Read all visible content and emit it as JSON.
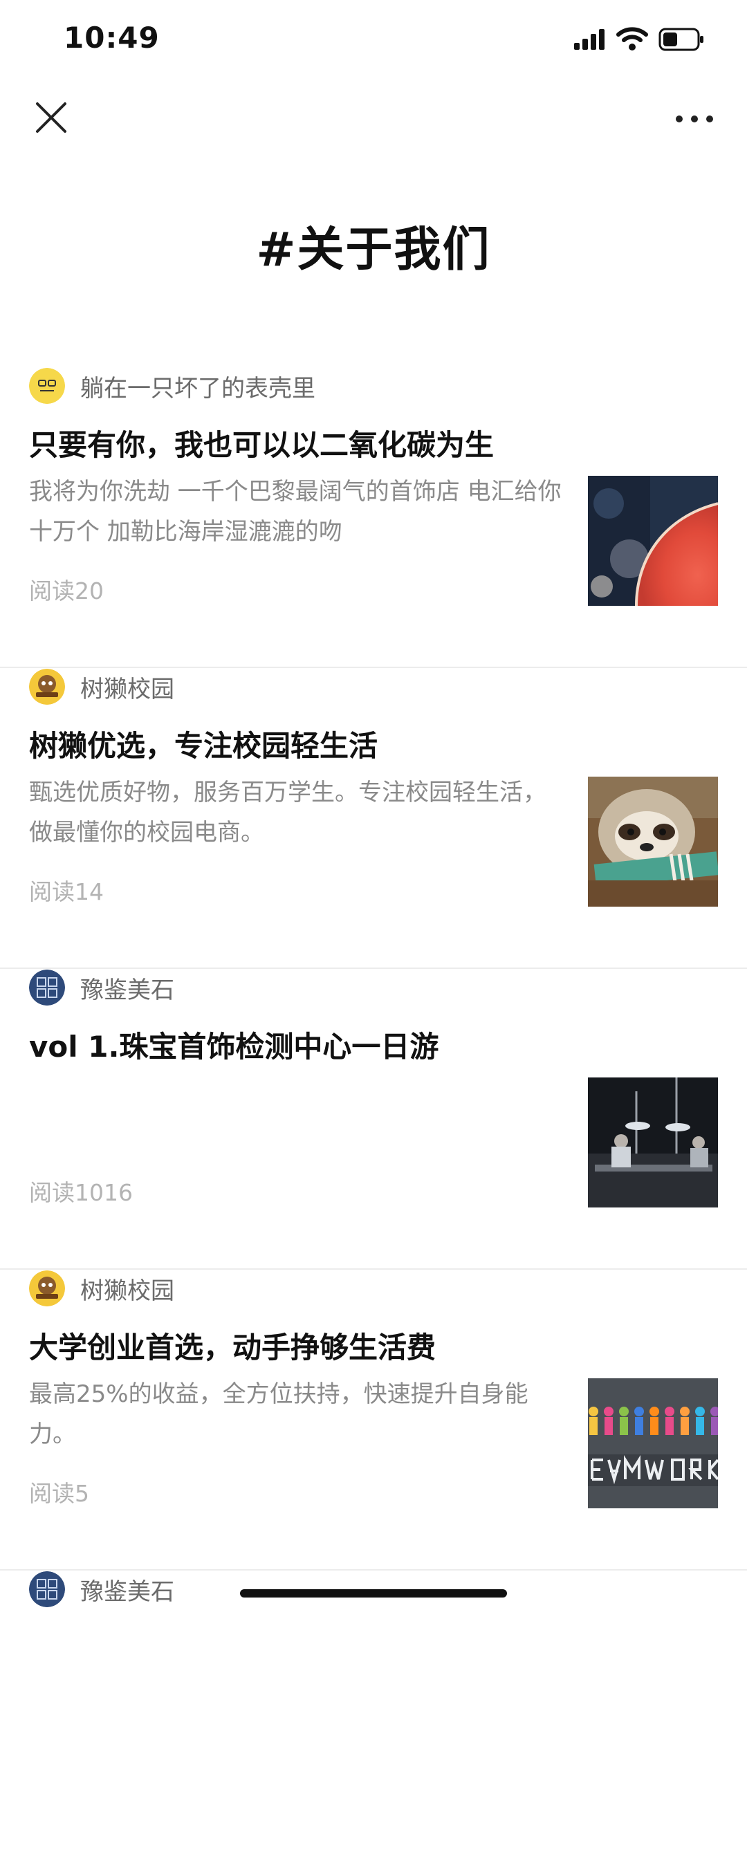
{
  "status_bar": {
    "time": "10:49"
  },
  "nav": {
    "close_icon": "close-icon",
    "more_icon": "more-dots-icon"
  },
  "page": {
    "title": "#关于我们"
  },
  "articles": [
    {
      "author": "躺在一只坏了的表壳里",
      "title": "只要有你，我也可以以二氧化碳为生",
      "desc": "我将为你洗劫 一千个巴黎最阔气的首饰店 电汇给你十万个 加勒比海岸湿漉漉的吻",
      "reads": "阅读20"
    },
    {
      "author": "树獭校园",
      "title": "树獭优选，专注校园轻生活",
      "desc": "甄选优质好物，服务百万学生。专注校园轻生活，做最懂你的校园电商。",
      "reads": "阅读14"
    },
    {
      "author": "豫鉴美石",
      "title": "vol 1.珠宝首饰检测中心一日游",
      "desc": "",
      "reads": "阅读1016"
    },
    {
      "author": "树獭校园",
      "title": "大学创业首选，动手挣够生活费",
      "desc": "最高25%的收益，全方位扶持，快速提升自身能力。",
      "reads": "阅读5"
    },
    {
      "author": "豫鉴美石",
      "title": "",
      "desc": "",
      "reads": ""
    }
  ]
}
